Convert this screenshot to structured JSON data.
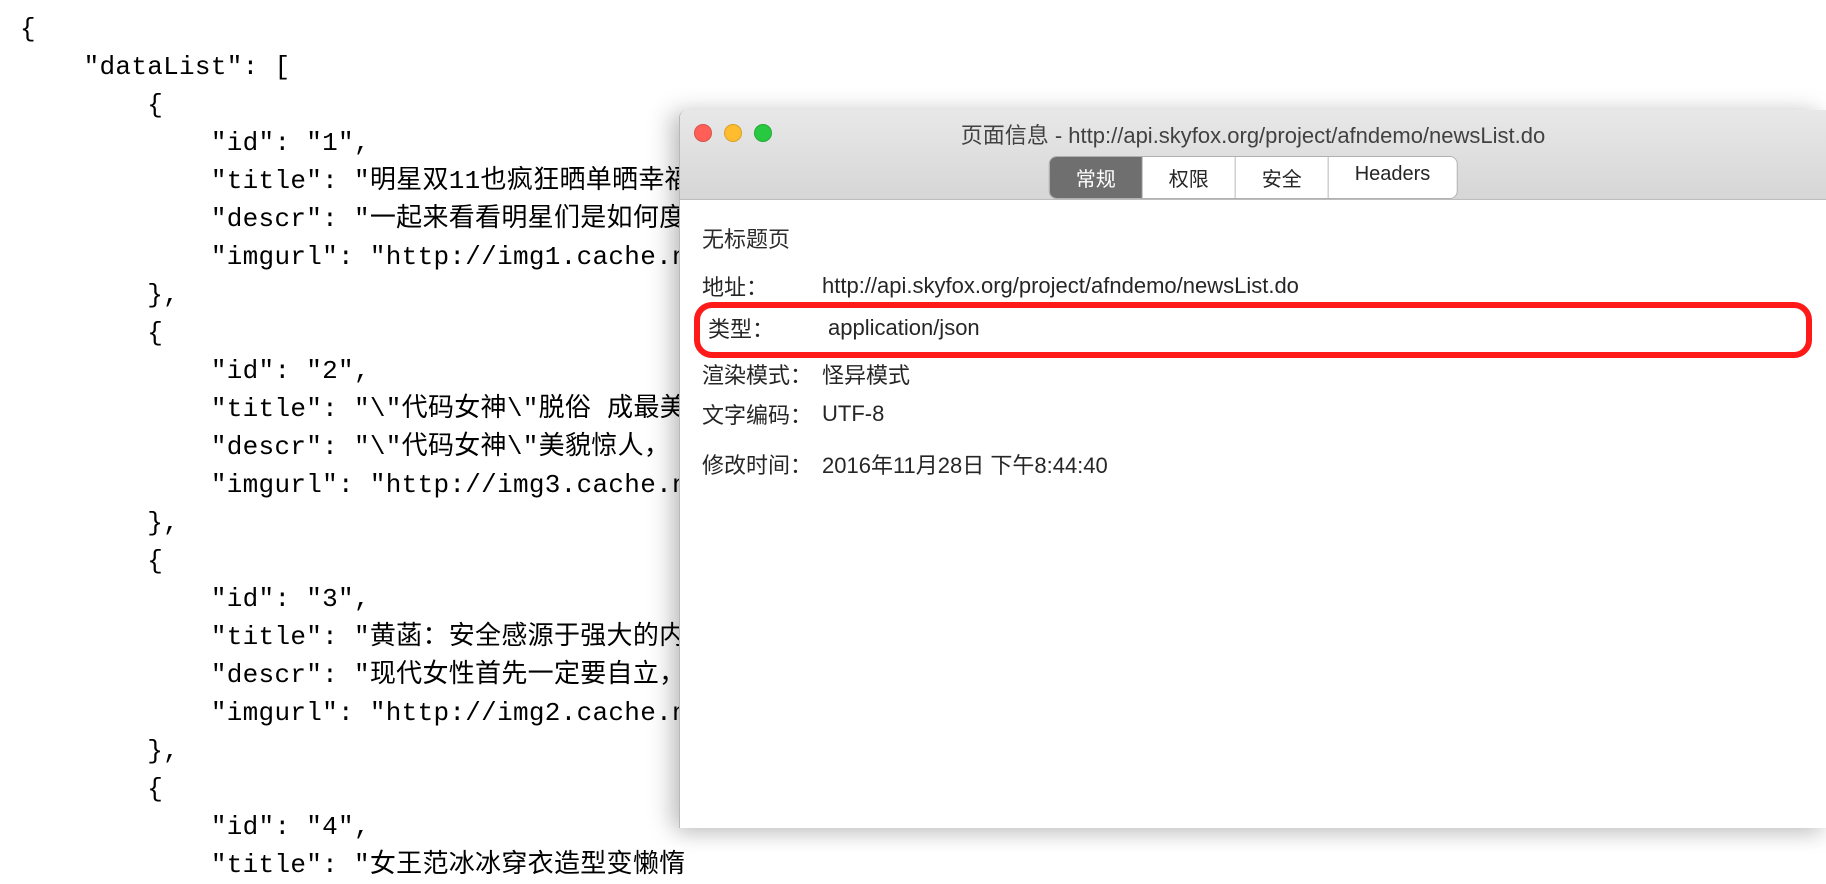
{
  "json_code": "{\n    \"dataList\": [\n        {\n            \"id\": \"1\",\n            \"title\": \"明星双11也疯狂晒单晒幸福\n            \"descr\": \"一起来看看明星们是如何度\n            \"imgurl\": \"http://img1.cache.n\n        },\n        {\n            \"id\": \"2\",\n            \"title\": \"\\\"代码女神\\\"脱俗 成最美\n            \"descr\": \"\\\"代码女神\\\"美貌惊人，\n            \"imgurl\": \"http://img3.cache.n\n        },\n        {\n            \"id\": \"3\",\n            \"title\": \"黄菡：安全感源于强大的内\n            \"descr\": \"现代女性首先一定要自立，\n            \"imgurl\": \"http://img2.cache.n\n        },\n        {\n            \"id\": \"4\",\n            \"title\": \"女王范冰冰穿衣造型变懒惰",
  "dialog": {
    "window_title": "页面信息 - http://api.skyfox.org/project/afndemo/newsList.do",
    "tabs": {
      "general": "常规",
      "permissions": "权限",
      "security": "安全",
      "headers": "Headers"
    },
    "section_title": "无标题页",
    "rows": {
      "address_label": "地址：",
      "address_value": "http://api.skyfox.org/project/afndemo/newsList.do",
      "type_label": "类型：",
      "type_value": "application/json",
      "render_label": "渲染模式：",
      "render_value": "怪异模式",
      "encoding_label": "文字编码：",
      "encoding_value": "UTF-8",
      "modified_label": "修改时间：",
      "modified_value": "2016年11月28日 下午8:44:40"
    }
  }
}
